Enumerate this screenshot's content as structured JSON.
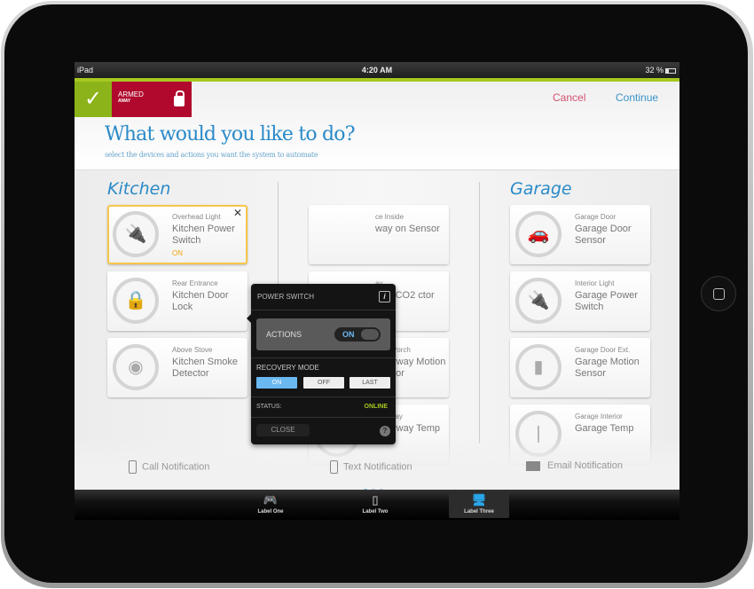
{
  "status_bar": {
    "device": "iPad",
    "time": "4:20 AM",
    "battery": "32 %"
  },
  "header": {
    "status_label": "ARMED",
    "status_mode": "AWAY",
    "cancel": "Cancel",
    "continue": "Continue",
    "title": "What would you like to do?",
    "subtitle": "select the devices and actions you want the system to automate"
  },
  "colors": {
    "accent_green": "#a7c820",
    "armed_red": "#b0092d",
    "title_blue": "#2a8ac8",
    "selected_border": "#f5c64a"
  },
  "sections": {
    "kitchen": {
      "title": "Kitchen",
      "cards": [
        {
          "location": "Overhead Light",
          "name": "Kitchen Power Switch",
          "state": "ON",
          "icon": "plug-icon",
          "selected": true
        },
        {
          "location": "Rear Entrance",
          "name": "Kitchen Door Lock",
          "icon": "lock-icon"
        },
        {
          "location": "Above Stove",
          "name": "Kitchen Smoke Detector",
          "icon": "smoke-detector-icon"
        }
      ]
    },
    "middle": {
      "cards": [
        {
          "location": "ce Inside",
          "name": "way on Sensor",
          "icon": "motion-sensor-icon"
        },
        {
          "location": "ay",
          "name": "way CO2 ctor",
          "icon": "co2-icon"
        },
        {
          "location": "Front Porch",
          "name": "Entryway Motion Sensor",
          "icon": "motion-sensor-icon"
        },
        {
          "location": "Entryway",
          "name": "Entryway Temp",
          "icon": "thermometer-icon"
        }
      ]
    },
    "garage": {
      "title": "Garage",
      "cards": [
        {
          "location": "Garage Door",
          "name": "Garage Door Sensor",
          "icon": "car-icon"
        },
        {
          "location": "Interior Light",
          "name": "Garage Power Switch",
          "icon": "plug-icon"
        },
        {
          "location": "Garage Door Ext.",
          "name": "Garage Motion Sensor",
          "icon": "motion-sensor-icon"
        },
        {
          "location": "Garage Interior",
          "name": "Garage Temp",
          "icon": "thermometer-icon"
        }
      ]
    }
  },
  "notifications": [
    "Call Notification",
    "Text Notification",
    "Email Notification"
  ],
  "popover": {
    "title": "POWER SWITCH",
    "info": "i",
    "actions_label": "ACTIONS",
    "actions_toggle": "ON",
    "recovery_label": "RECOVERY MODE",
    "recovery_options": [
      "ON",
      "OFF",
      "LAST"
    ],
    "recovery_selected": "ON",
    "status_label": "STATUS:",
    "status_value": "ONLINE",
    "close": "CLOSE",
    "help": "?"
  },
  "tabs": [
    {
      "label": "Label One",
      "icon": "gamepad-icon"
    },
    {
      "label": "Label Two",
      "icon": "ipod-icon"
    },
    {
      "label": "Label Three",
      "icon": "computer-icon",
      "active": true
    }
  ]
}
